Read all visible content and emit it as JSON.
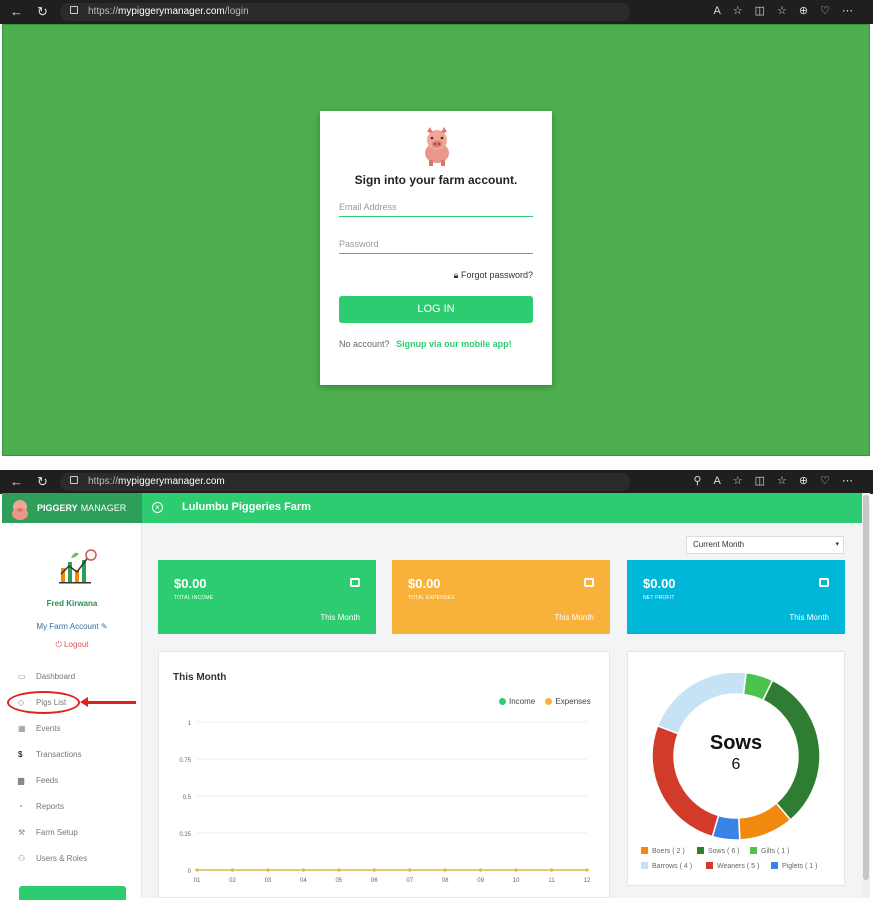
{
  "login_browser": {
    "url_prefix": "https://",
    "url_host": "mypiggerymanager.com",
    "url_path": "/login"
  },
  "login": {
    "title": "Sign into your farm account.",
    "email_placeholder": "Email Address",
    "password_placeholder": "Password",
    "forgot": "Forgot password?",
    "button": "LOG IN",
    "no_account": "No account?",
    "signup": "Signup via our mobile app!"
  },
  "dash_browser": {
    "url_prefix": "https://",
    "url_host": "mypiggerymanager.com"
  },
  "brand": {
    "bold": "PIGGERY",
    "light": "MANAGER"
  },
  "farm_name": "Lulumbu Piggeries Farm",
  "user": {
    "name": "Fred Kirwana",
    "account_link": "My Farm Account",
    "logout": "Logout"
  },
  "menu": [
    {
      "label": "Dashboard",
      "icon": "monitor-icon"
    },
    {
      "label": "Pigs List",
      "icon": "tag-icon"
    },
    {
      "label": "Events",
      "icon": "calendar-icon"
    },
    {
      "label": "Transactions",
      "icon": "dollar-icon"
    },
    {
      "label": "Feeds",
      "icon": "bag-icon"
    },
    {
      "label": "Reports",
      "icon": "pie-icon"
    },
    {
      "label": "Farm Setup",
      "icon": "wrench-icon"
    },
    {
      "label": "Users & Roles",
      "icon": "users-icon"
    }
  ],
  "period_select": "Current Month",
  "stats": [
    {
      "value": "$0.00",
      "label": "TOTAL INCOME",
      "period": "This Month",
      "color": "#2ecc71"
    },
    {
      "value": "$0.00",
      "label": "TOTAL EXPENSES",
      "period": "This Month",
      "color": "#f8b13b"
    },
    {
      "value": "$0.00",
      "label": "NET PROFIT",
      "period": "This Month",
      "color": "#00b7da"
    }
  ],
  "line_panel": {
    "title": "This Month",
    "legend_income": "Income",
    "legend_expenses": "Expenses"
  },
  "chart_data": [
    {
      "type": "line",
      "title": "This Month",
      "x": [
        "01",
        "02",
        "03",
        "04",
        "05",
        "06",
        "07",
        "08",
        "09",
        "10",
        "11",
        "12"
      ],
      "yticks": [
        "1",
        "0.75",
        "0.5",
        "0.25",
        "0"
      ],
      "ylim": [
        0,
        1
      ],
      "series": [
        {
          "name": "Income",
          "values": [
            0,
            0,
            0,
            0,
            0,
            0,
            0,
            0,
            0,
            0,
            0,
            0
          ],
          "color": "#2ecc71"
        },
        {
          "name": "Expenses",
          "values": [
            0,
            0,
            0,
            0,
            0,
            0,
            0,
            0,
            0,
            0,
            0,
            0
          ],
          "color": "#f8b13b"
        }
      ],
      "grid": true,
      "legend": "top-right"
    },
    {
      "type": "pie",
      "center_label": "Sows",
      "center_value": "6",
      "slices": [
        {
          "name": "Boers ( 2 )",
          "value": 2,
          "color": "#f0890e"
        },
        {
          "name": "Sows ( 6 )",
          "value": 6,
          "color": "#2e7d32"
        },
        {
          "name": "Gilts ( 1 )",
          "value": 1,
          "color": "#4cc34f"
        },
        {
          "name": "Barrows ( 4 )",
          "value": 4,
          "color": "#c5e3f4"
        },
        {
          "name": "Weaners ( 5 )",
          "value": 5,
          "color": "#d23a2a"
        },
        {
          "name": "Piglets ( 1 )",
          "value": 1,
          "color": "#3b82e6"
        }
      ],
      "order": [
        "Gilts ( 1 )",
        "Sows ( 6 )",
        "Boers ( 2 )",
        "Piglets ( 1 )",
        "Weaners ( 5 )",
        "Barrows ( 4 )"
      ]
    }
  ]
}
